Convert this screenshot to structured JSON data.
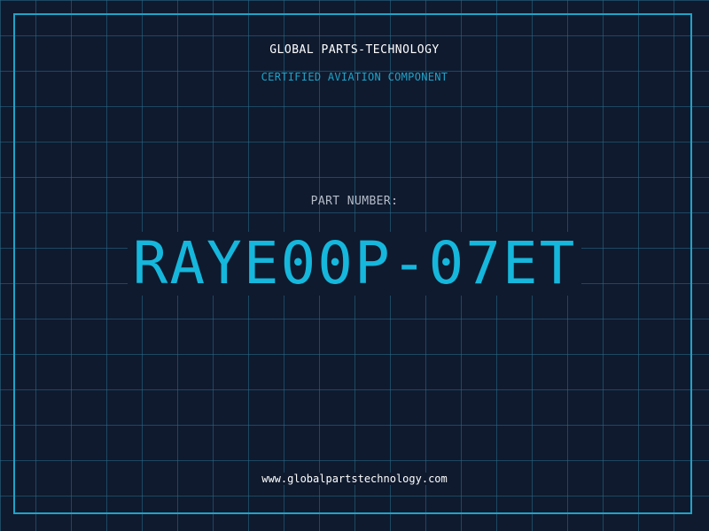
{
  "header": {
    "company": "GLOBAL PARTS-TECHNOLOGY",
    "subtitle": "CERTIFIED AVIATION COMPONENT"
  },
  "part": {
    "label": "PART NUMBER:",
    "number": "RAYE00P-07ET"
  },
  "footer": {
    "website": "www.globalpartstechnology.com"
  },
  "colors": {
    "background": "#0f1a2e",
    "accent": "#1fa3c8",
    "part_number": "#16b7dc",
    "text_primary": "#ffffff",
    "text_muted": "#b4bcc8"
  }
}
